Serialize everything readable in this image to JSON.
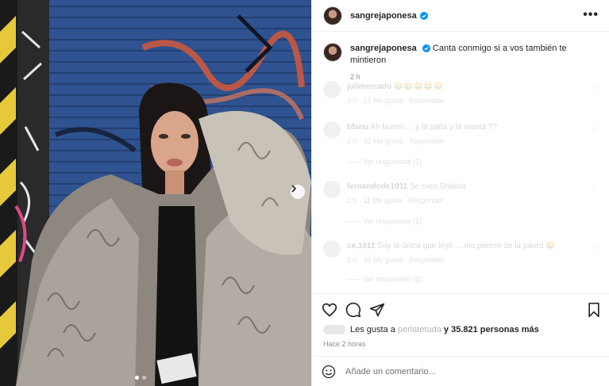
{
  "post": {
    "username": "sangrejaponesa",
    "caption": "Canta conmigo si a vos también te mintieron",
    "caption_time": "2 h"
  },
  "comments": [
    {
      "user": "julimercado",
      "text": "😂😂😂😂😂",
      "meta": "2 h · 17 Me gusta · Responder"
    },
    {
      "user": "bfanu",
      "text": "Ah bueno ... y la palta y la manta ??",
      "meta": "2 h · 33 Me gusta · Responder",
      "replies": "—— Ver respuestas (1)"
    },
    {
      "user": "fernandode1911",
      "text": "Se creo Shakira",
      "meta": "2 h · 11 Me gusta · Responder",
      "replies": "—— Ver respuestas (1)"
    },
    {
      "user": "ce.1911",
      "text": "Soy la única que leyó ... me parece de la pared 😂",
      "meta": "2 h · 40 Me gusta · Responder",
      "replies": "—— Ver respuestas (1)"
    }
  ],
  "likes": {
    "prefix": "Les gusta a",
    "name": "perlatetuda",
    "suffix": "y 35.821 personas más"
  },
  "posted_ago": "Hace 2 horas",
  "comment_input": {
    "placeholder": "Añade un comentario..."
  },
  "icons": {
    "more": "more-options-icon",
    "verified": "verified-badge-icon",
    "like": "heart-icon",
    "comment": "comment-icon",
    "share": "share-icon",
    "save": "bookmark-icon",
    "emoji": "emoji-icon",
    "next": "chevron-right-icon"
  },
  "colors": {
    "verified": "#0095f6",
    "text": "#262626",
    "muted": "#8e8e8e"
  }
}
